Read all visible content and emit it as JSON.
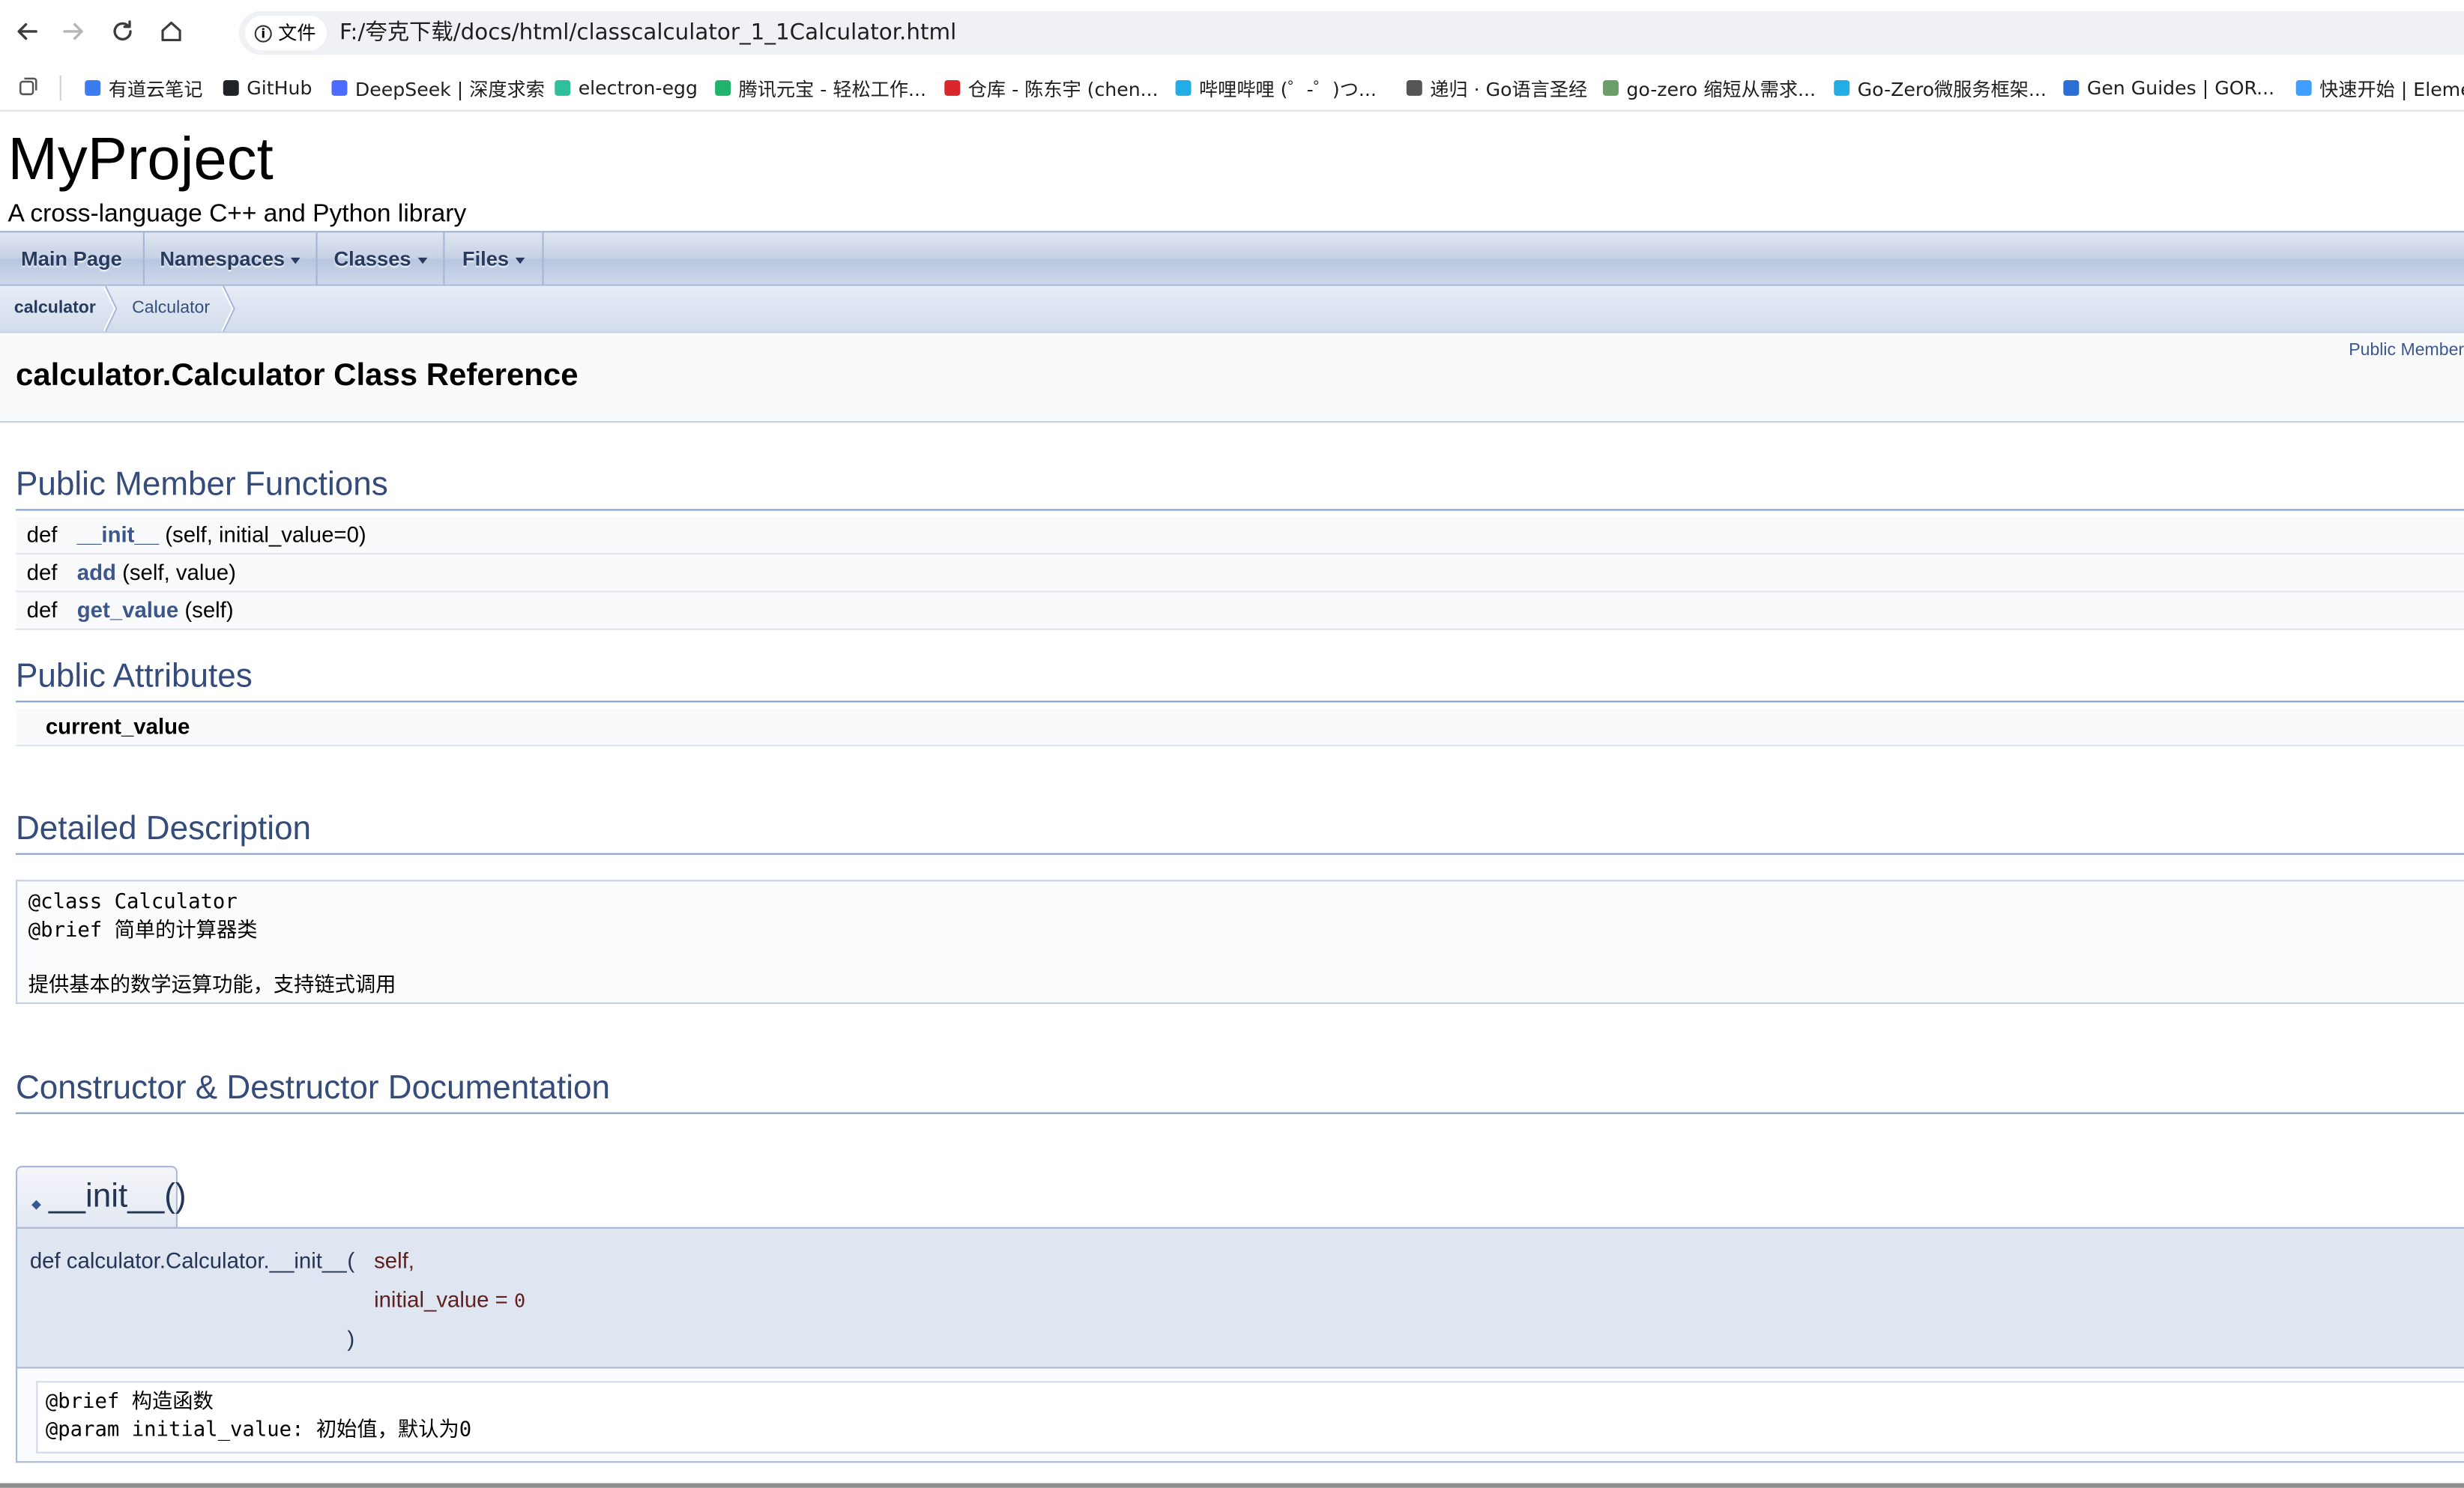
{
  "browser": {
    "address_chip_label": "文件",
    "url": "F:/夸克下载/docs/html/classcalculator_1_1Calculator.html",
    "bookmarks": [
      {
        "label": "有道云笔记",
        "color": "#3b7cf0"
      },
      {
        "label": "GitHub",
        "color": "#1f2328"
      },
      {
        "label": "DeepSeek | 深度求索",
        "color": "#4d6bfe"
      },
      {
        "label": "electron-egg",
        "color": "#2fbf9a"
      },
      {
        "label": "腾讯元宝 - 轻松工作...",
        "color": "#21b26c"
      },
      {
        "label": "仓库 - 陈东宇 (chen...",
        "color": "#d9262c"
      },
      {
        "label": "哔哩哔哩 (゜-゜)つ...",
        "color": "#23ade5"
      },
      {
        "label": "递归 · Go语言圣经",
        "color": "#555555"
      },
      {
        "label": "go-zero 缩短从需求...",
        "color": "#6a9f6a"
      },
      {
        "label": "Go-Zero微服务框架...",
        "color": "#23ade5"
      },
      {
        "label": "Gen Guides | GOR...",
        "color": "#2b6fd6"
      },
      {
        "label": "快速开始 | Elemen",
        "color": "#409eff"
      }
    ]
  },
  "project": {
    "name": "MyProject",
    "brief": "A cross-language C++ and Python library"
  },
  "nav": {
    "items": [
      {
        "label": "Main Page",
        "dropdown": false
      },
      {
        "label": "Namespaces",
        "dropdown": true
      },
      {
        "label": "Classes",
        "dropdown": true
      },
      {
        "label": "Files",
        "dropdown": true
      }
    ]
  },
  "breadcrumb": [
    "calculator",
    "Calculator"
  ],
  "header": {
    "summary_link": "Public Member",
    "title": "calculator.Calculator Class Reference"
  },
  "public_member_functions": {
    "heading": "Public Member Functions",
    "rows": [
      {
        "kw": "def",
        "name": "__init__",
        "args": " (self, initial_value=0)"
      },
      {
        "kw": "def",
        "name": "add",
        "args": " (self, value)"
      },
      {
        "kw": "def",
        "name": "get_value",
        "args": " (self)"
      }
    ]
  },
  "public_attributes": {
    "heading": "Public Attributes",
    "rows": [
      {
        "name": "current_value"
      }
    ]
  },
  "detailed_description": {
    "heading": "Detailed Description",
    "text": "@class Calculator\n@brief 简单的计算器类\n\n提供基本的数学运算功能，支持链式调用"
  },
  "constructor_doc": {
    "heading": "Constructor & Destructor Documentation",
    "member_title": "__init__()",
    "signature": "def calculator.Calculator.__init__",
    "paren_open": "(",
    "param1": "self,",
    "param2_name": "initial_value = ",
    "param2_default": "0",
    "paren_close": ")",
    "doc": "@brief 构造函数\n@param initial_value: 初始值，默认为0"
  }
}
